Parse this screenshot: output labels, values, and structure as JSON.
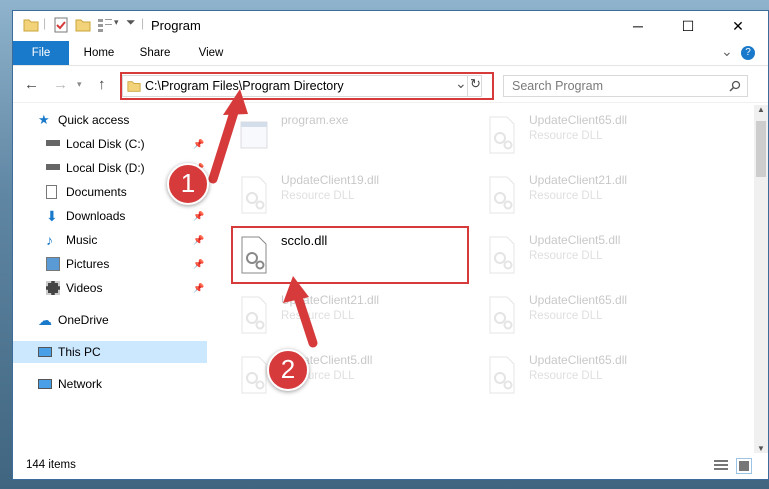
{
  "window": {
    "title": "Program",
    "minimize": "─",
    "maximize": "☐",
    "close": "✕"
  },
  "ribbon": {
    "tabs": [
      "File",
      "Home",
      "Share",
      "View"
    ],
    "expand": "⌄",
    "help": "?"
  },
  "address": {
    "path": "C:\\Program Files\\Program Directory",
    "dropdown": "⌄",
    "refresh": "↻"
  },
  "search": {
    "placeholder": "Search Program"
  },
  "nav_pane": {
    "quick_access": "Quick access",
    "items": [
      {
        "label": "Local Disk (C:)",
        "pinned": true
      },
      {
        "label": "Local Disk (D:)",
        "pinned": true
      },
      {
        "label": "Documents",
        "pinned": true
      },
      {
        "label": "Downloads",
        "pinned": true
      },
      {
        "label": "Music",
        "pinned": true
      },
      {
        "label": "Pictures",
        "pinned": true
      },
      {
        "label": "Videos",
        "pinned": true
      }
    ],
    "onedrive": "OneDrive",
    "this_pc": "This PC",
    "network": "Network"
  },
  "files": [
    {
      "name": "program.exe",
      "type": ""
    },
    {
      "name": "UpdateClient65.dll",
      "type": "Resource DLL"
    },
    {
      "name": "UpdateClient19.dll",
      "type": "Resource DLL"
    },
    {
      "name": "UpdateClient21.dll",
      "type": "Resource DLL"
    },
    {
      "name": "scclo.dll",
      "type": ""
    },
    {
      "name": "UpdateClient5.dll",
      "type": "Resource DLL"
    },
    {
      "name": "UpdateClient21.dll",
      "type": "Resource DLL"
    },
    {
      "name": "UpdateClient65.dll",
      "type": "Resource DLL"
    },
    {
      "name": "UpdateClient5.dll",
      "type": "Resource DLL"
    },
    {
      "name": "UpdateClient65.dll",
      "type": "Resource DLL"
    }
  ],
  "status": {
    "item_count": "144 items"
  },
  "annotations": {
    "step1": "1",
    "step2": "2"
  },
  "colors": {
    "accent": "#1979ca",
    "highlight": "#d63a3a",
    "selected": "#cce8ff"
  }
}
